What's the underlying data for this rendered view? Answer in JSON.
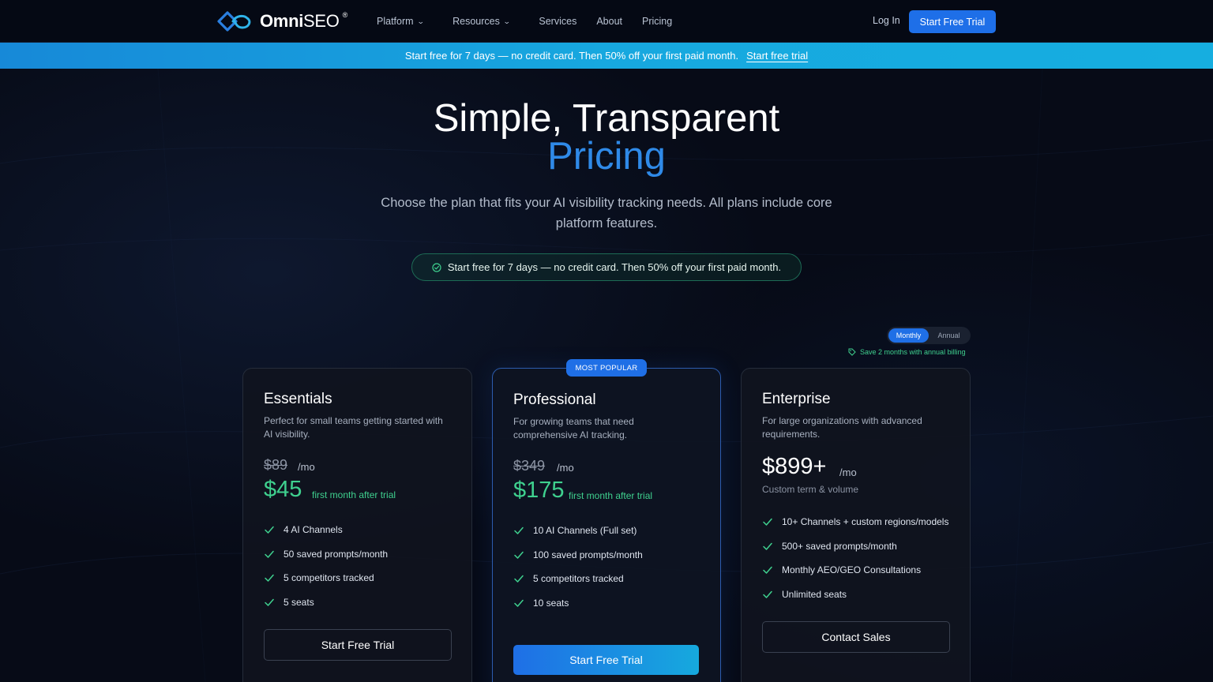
{
  "brand": {
    "name_bold": "Omni",
    "name_thin": "SEO",
    "registered": "®"
  },
  "nav": {
    "items": [
      {
        "label": "Platform",
        "has_menu": true
      },
      {
        "label": "Resources",
        "has_menu": true
      },
      {
        "label": "Services",
        "has_menu": false
      },
      {
        "label": "About",
        "has_menu": false
      },
      {
        "label": "Pricing",
        "has_menu": false
      }
    ],
    "login": "Log In",
    "cta": "Start Free Trial"
  },
  "promo_bar": {
    "text": "Start free for 7 days — no credit card. Then 50% off your first paid month.",
    "link": "Start free trial"
  },
  "hero": {
    "title_line1": "Simple, Transparent",
    "title_line2": "Pricing",
    "subtitle": "Choose the plan that fits your AI visibility tracking needs. All plans include core platform features.",
    "pill": "Start free for 7 days — no credit card. Then 50% off your first paid month."
  },
  "billing": {
    "monthly": "Monthly",
    "annual": "Annual",
    "selected": "Monthly",
    "save_note": "Save 2 months with annual billing"
  },
  "popular_badge": "MOST POPULAR",
  "plans": [
    {
      "name": "Essentials",
      "description": "Perfect for small teams getting started with AI visibility.",
      "old_price": "$89",
      "per": "/mo",
      "trial_price": "$45",
      "trial_note": "first month after trial",
      "features": [
        "4 AI Channels",
        "50 saved prompts/month",
        "5 competitors tracked",
        "5 seats"
      ],
      "cta": "Start Free Trial"
    },
    {
      "name": "Professional",
      "description": "For growing teams that need comprehensive AI tracking.",
      "old_price": "$349",
      "per": "/mo",
      "trial_price": "$175",
      "trial_note": "first month after trial",
      "features": [
        "10 AI Channels (Full set)",
        "100 saved prompts/month",
        "5 competitors tracked",
        "10 seats"
      ],
      "cta": "Start Free Trial"
    },
    {
      "name": "Enterprise",
      "description": "For large organizations with advanced requirements.",
      "price": "$899+",
      "per": "/mo",
      "term": "Custom term & volume",
      "features": [
        "10+ Channels + custom regions/models",
        "500+ saved prompts/month",
        "Monthly AEO/GEO Consultations",
        "Unlimited seats"
      ],
      "cta": "Contact Sales"
    }
  ],
  "colors": {
    "background": "#070b17",
    "accent_blue": "#1f6fe6",
    "accent_cyan": "#16a9de",
    "price_green": "#3fd18f",
    "title_blue": "#2f8ae8"
  },
  "icons": {
    "logo": "logo-mark-icon",
    "dropdown": "chevron-down-icon",
    "pill": "check-circle-icon",
    "save_note": "tag-icon",
    "feature": "check-icon"
  }
}
